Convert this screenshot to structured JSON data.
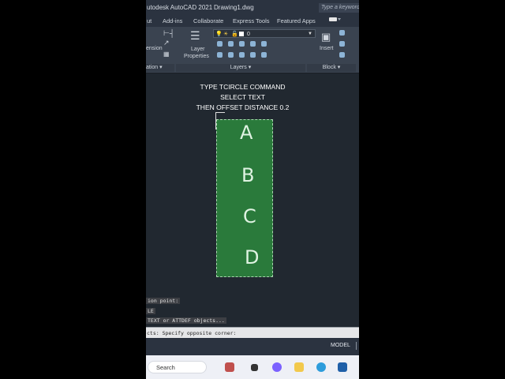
{
  "window": {
    "title": "utodesk AutoCAD 2021",
    "document": "Drawing1.dwg",
    "search_placeholder": "Type a keyword"
  },
  "ribbon_tabs": [
    "ut",
    "Add-ins",
    "Collaborate",
    "Express Tools",
    "Featured Apps"
  ],
  "ribbon": {
    "dimension_label": "ension",
    "layer_properties_label1": "Layer",
    "layer_properties_label2": "Properties",
    "layer_current": "0",
    "insert_label": "Insert",
    "panels": {
      "annotation": "ation",
      "layers": "Layers",
      "block": "Block"
    }
  },
  "instructions": {
    "line1": "TYPE TCIRCLE COMMAND",
    "line2": "SELECT TEXT",
    "line3": "THEN OFFSET DISTANCE 0.2"
  },
  "drawing": {
    "letters": [
      "A",
      "B",
      "C",
      "D"
    ],
    "fill_color": "#2a7a3b",
    "border_color": "#a9d6b0"
  },
  "command_history": {
    "line1": "ion point:",
    "line2": "LE",
    "line3": "TEXT or ATTDEF objects..."
  },
  "command_prompt": "cts: Specify opposite corner:",
  "status": {
    "model": "MODEL"
  },
  "taskbar": {
    "search_label": "Search"
  }
}
